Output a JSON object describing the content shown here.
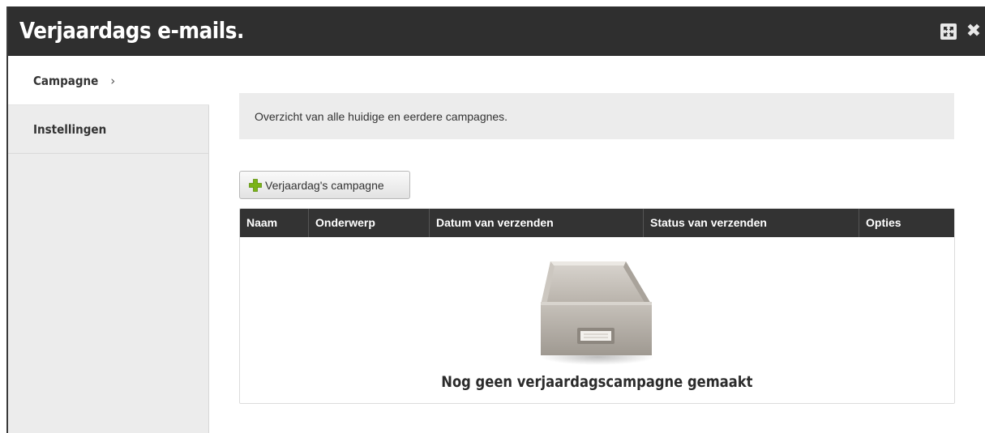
{
  "window": {
    "title": "Verjaardags e-mails.",
    "controls": {
      "expand_icon": "expand-icon",
      "close_icon": "close-icon",
      "close_glyph": "✖"
    }
  },
  "sidebar": {
    "items": [
      {
        "label": "Campagne",
        "active": true,
        "chevron": "›"
      },
      {
        "label": "Instellingen",
        "active": false
      }
    ]
  },
  "main": {
    "info_text": "Overzicht van alle huidige en eerdere campagnes.",
    "new_campaign_button": "Verjaardag's campagne",
    "table": {
      "columns": [
        "Naam",
        "Onderwerp",
        "Datum van verzenden",
        "Status van verzenden",
        "Opties"
      ],
      "rows": [],
      "empty_message": "Nog geen verjaardagscampagne gemaakt",
      "empty_icon": "empty-drawer-icon"
    }
  },
  "colors": {
    "titlebar": "#2f2f2f",
    "sidebar": "#ececec",
    "table_header": "#333333",
    "plus_green": "#7ab317"
  }
}
